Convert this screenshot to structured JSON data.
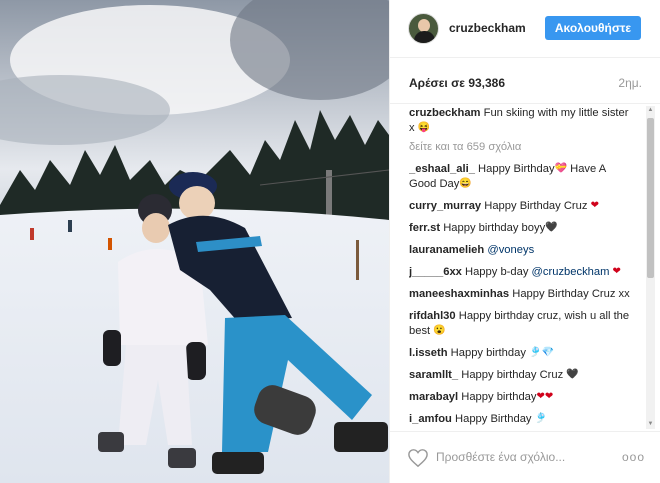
{
  "post": {
    "image_alt": "Two children in ski gear on a snowy slope"
  },
  "header": {
    "username": "cruzbeckham",
    "follow_label": "Ακολουθήστε"
  },
  "stats": {
    "likes_text": "Αρέσει σε 93,386",
    "time_ago": "2ημ."
  },
  "caption": {
    "user": "cruzbeckham",
    "text": "Fun skiing with my little sister x",
    "emoji": "😝"
  },
  "view_all": "δείτε και τα 659 σχόλια",
  "comments": [
    {
      "user": "_eshaal_ali_",
      "text": "Happy Birthday",
      "emoji": "💝",
      "text2": "Have A Good Day",
      "emoji2": "😄"
    },
    {
      "user": "curry_murray",
      "text": "Happy Birthday Cruz",
      "emoji": "❤"
    },
    {
      "user": "ferr.st",
      "text": "Happy birthday boyy",
      "emoji": "🖤"
    },
    {
      "user": "lauranamelieh",
      "mention": "@voneys"
    },
    {
      "user": "j_____6xx",
      "text": "Happy b-day",
      "mention": "@cruzbeckham",
      "emoji": "❤"
    },
    {
      "user": "maneeshaxminhas",
      "text": "Happy Birthday Cruz xx"
    },
    {
      "user": "rifdahl30",
      "text": "Happy birthday cruz, wish u all the best",
      "emoji": "😮"
    },
    {
      "user": "l.isseth",
      "text": "Happy birthday",
      "emoji": "🎐💎"
    },
    {
      "user": "saramllt_",
      "text": "Happy birthday Cruz",
      "emoji": "🖤"
    },
    {
      "user": "marabayl",
      "text": "Happy birthday",
      "emoji": "❤❤"
    },
    {
      "user": "i_amfou",
      "text": "Happy Birthday",
      "emoji": "🎐"
    }
  ],
  "footer": {
    "comment_placeholder": "Προσθέστε ένα σχόλιο...",
    "more_label": "ooo"
  },
  "colors": {
    "accent": "#3897f0",
    "mention": "#003569",
    "muted": "#999999"
  }
}
